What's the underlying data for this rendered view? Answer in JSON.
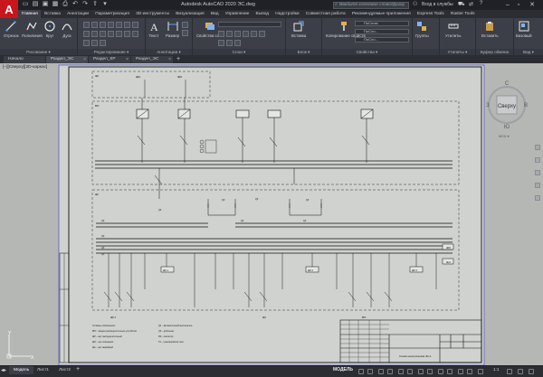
{
  "window": {
    "app_title": "Autodesk AutoCAD 2020   ЭС.dwg",
    "search_placeholder": "Введите ключевое слово/фразу",
    "signin_label": "Вход в службы"
  },
  "ribbon_tabs": [
    "Главная",
    "Вставка",
    "Аннотации",
    "Параметризация",
    "3D-инструменты",
    "Визуализация",
    "Вид",
    "Управление",
    "Вывод",
    "Надстройки",
    "Совместная работа",
    "Рекомендуемые приложения",
    "Express Tools",
    "Raster Tools"
  ],
  "ribbon": {
    "draw": {
      "title": "Рисование ▾",
      "buttons": [
        "Отрезок",
        "Полилиния",
        "Круг",
        "Дуга"
      ]
    },
    "modify": {
      "title": "Редактирование ▾"
    },
    "annotation": {
      "title": "Аннотации ▾",
      "buttons": [
        "Текст",
        "Размер"
      ]
    },
    "layers": {
      "title": "Слои ▾",
      "buttons": [
        "Свойства слоя"
      ]
    },
    "block": {
      "title": "Блок ▾",
      "buttons": [
        "Вставка"
      ]
    },
    "properties": {
      "title": "Свойства ▾",
      "buttons": [
        "Копирование свойств"
      ],
      "dropdowns": [
        "ПоСлою",
        "ПоСло...",
        "ПоСло..."
      ]
    },
    "groups": {
      "title": "",
      "buttons": [
        "Группы"
      ]
    },
    "utilities": {
      "title": "Утилиты ▾",
      "buttons": [
        "Утилиты"
      ]
    },
    "clipboard": {
      "title": "Буфер обмена",
      "buttons": [
        "Вставить"
      ]
    },
    "view": {
      "title": "Вид ▾",
      "buttons": [
        "Базовый"
      ]
    }
  },
  "file_tabs": [
    {
      "label": "Начало",
      "active": false
    },
    {
      "label": "Раздел_ЭС",
      "active": true
    },
    {
      "label": "Раздел_КР",
      "active": false
    },
    {
      "label": "Раздел_ЭС",
      "active": false
    }
  ],
  "viewport_label": "[−][Сверху][2D-каркас]",
  "viewcube": {
    "top": "Сверху",
    "north": "С",
    "south": "Ю",
    "west": "З",
    "east": "В",
    "wcs": "МСК ▾"
  },
  "drawing": {
    "stamp_text": "Схема электрическая ЭС-1",
    "panel_labels": [
      "ВРУ",
      "ЩР-1",
      "ЩР-2",
      "ЩР-3",
      "ЩР-4",
      "ЩО"
    ],
    "side_labels": [
      "ЩВ1",
      "ЩА1"
    ],
    "legend_title": "Условные обозначения:",
    "legend_lines": [
      "ВРУ – вводно-распределительное устройство",
      "ЩР – щит распределительный",
      "ЩО – щит освещения",
      "ЩА – щит аварийный",
      "QF – автоматический выключатель",
      "QS – рубильник",
      "КМ – контактор",
      "ТА – трансформатор тока"
    ]
  },
  "layout_tabs": [
    {
      "label": "Модель",
      "active": true
    },
    {
      "label": "Лист1",
      "active": false
    },
    {
      "label": "Лист2",
      "active": false
    }
  ],
  "status": {
    "model_label": "МОДЕЛЬ",
    "scale": "1:1"
  }
}
